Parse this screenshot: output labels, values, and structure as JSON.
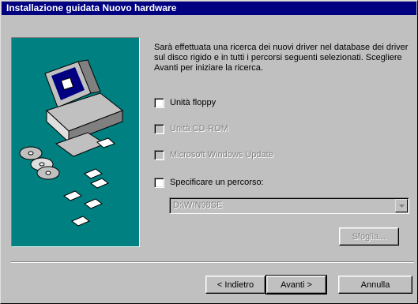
{
  "window": {
    "title": "Installazione guidata Nuovo hardware"
  },
  "description": "Sarà effettuata una ricerca dei nuovi driver nel database dei driver sul disco rigido e in tutti i percorsi seguenti selezionati. Scegliere Avanti per iniziare la ricerca.",
  "options": [
    {
      "label": "Unità floppy",
      "checked": false,
      "enabled": true
    },
    {
      "label": "Unità CD-ROM",
      "checked": false,
      "enabled": false
    },
    {
      "label": "Microsoft Windows Update",
      "checked": false,
      "enabled": false
    },
    {
      "label": "Specificare un percorso:",
      "checked": false,
      "enabled": true
    }
  ],
  "path_combo": {
    "value": "D:\\WIN98SE",
    "enabled": false
  },
  "buttons": {
    "browse": "Sfoglia...",
    "back": "< Indietro",
    "next": "Avanti >",
    "cancel": "Annulla"
  },
  "icons": {
    "illustration": "computer-with-discs-icon",
    "dropdown": "chevron-down-icon"
  },
  "colors": {
    "title_bar": "#000080",
    "illustration_bg": "#008080",
    "face": "#c0c0c0"
  }
}
